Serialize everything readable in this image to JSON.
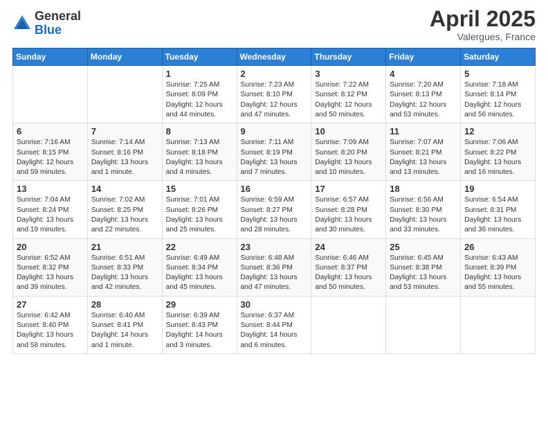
{
  "header": {
    "logo_general": "General",
    "logo_blue": "Blue",
    "month_title": "April 2025",
    "location": "Valergues, France"
  },
  "weekdays": [
    "Sunday",
    "Monday",
    "Tuesday",
    "Wednesday",
    "Thursday",
    "Friday",
    "Saturday"
  ],
  "weeks": [
    [
      {
        "day": "",
        "info": ""
      },
      {
        "day": "",
        "info": ""
      },
      {
        "day": "1",
        "info": "Sunrise: 7:25 AM\nSunset: 8:09 PM\nDaylight: 12 hours and 44 minutes."
      },
      {
        "day": "2",
        "info": "Sunrise: 7:23 AM\nSunset: 8:10 PM\nDaylight: 12 hours and 47 minutes."
      },
      {
        "day": "3",
        "info": "Sunrise: 7:22 AM\nSunset: 8:12 PM\nDaylight: 12 hours and 50 minutes."
      },
      {
        "day": "4",
        "info": "Sunrise: 7:20 AM\nSunset: 8:13 PM\nDaylight: 12 hours and 53 minutes."
      },
      {
        "day": "5",
        "info": "Sunrise: 7:18 AM\nSunset: 8:14 PM\nDaylight: 12 hours and 56 minutes."
      }
    ],
    [
      {
        "day": "6",
        "info": "Sunrise: 7:16 AM\nSunset: 8:15 PM\nDaylight: 12 hours and 59 minutes."
      },
      {
        "day": "7",
        "info": "Sunrise: 7:14 AM\nSunset: 8:16 PM\nDaylight: 13 hours and 1 minute."
      },
      {
        "day": "8",
        "info": "Sunrise: 7:13 AM\nSunset: 8:18 PM\nDaylight: 13 hours and 4 minutes."
      },
      {
        "day": "9",
        "info": "Sunrise: 7:11 AM\nSunset: 8:19 PM\nDaylight: 13 hours and 7 minutes."
      },
      {
        "day": "10",
        "info": "Sunrise: 7:09 AM\nSunset: 8:20 PM\nDaylight: 13 hours and 10 minutes."
      },
      {
        "day": "11",
        "info": "Sunrise: 7:07 AM\nSunset: 8:21 PM\nDaylight: 13 hours and 13 minutes."
      },
      {
        "day": "12",
        "info": "Sunrise: 7:06 AM\nSunset: 8:22 PM\nDaylight: 13 hours and 16 minutes."
      }
    ],
    [
      {
        "day": "13",
        "info": "Sunrise: 7:04 AM\nSunset: 8:24 PM\nDaylight: 13 hours and 19 minutes."
      },
      {
        "day": "14",
        "info": "Sunrise: 7:02 AM\nSunset: 8:25 PM\nDaylight: 13 hours and 22 minutes."
      },
      {
        "day": "15",
        "info": "Sunrise: 7:01 AM\nSunset: 8:26 PM\nDaylight: 13 hours and 25 minutes."
      },
      {
        "day": "16",
        "info": "Sunrise: 6:59 AM\nSunset: 8:27 PM\nDaylight: 13 hours and 28 minutes."
      },
      {
        "day": "17",
        "info": "Sunrise: 6:57 AM\nSunset: 8:28 PM\nDaylight: 13 hours and 30 minutes."
      },
      {
        "day": "18",
        "info": "Sunrise: 6:56 AM\nSunset: 8:30 PM\nDaylight: 13 hours and 33 minutes."
      },
      {
        "day": "19",
        "info": "Sunrise: 6:54 AM\nSunset: 8:31 PM\nDaylight: 13 hours and 36 minutes."
      }
    ],
    [
      {
        "day": "20",
        "info": "Sunrise: 6:52 AM\nSunset: 8:32 PM\nDaylight: 13 hours and 39 minutes."
      },
      {
        "day": "21",
        "info": "Sunrise: 6:51 AM\nSunset: 8:33 PM\nDaylight: 13 hours and 42 minutes."
      },
      {
        "day": "22",
        "info": "Sunrise: 6:49 AM\nSunset: 8:34 PM\nDaylight: 13 hours and 45 minutes."
      },
      {
        "day": "23",
        "info": "Sunrise: 6:48 AM\nSunset: 8:36 PM\nDaylight: 13 hours and 47 minutes."
      },
      {
        "day": "24",
        "info": "Sunrise: 6:46 AM\nSunset: 8:37 PM\nDaylight: 13 hours and 50 minutes."
      },
      {
        "day": "25",
        "info": "Sunrise: 6:45 AM\nSunset: 8:38 PM\nDaylight: 13 hours and 53 minutes."
      },
      {
        "day": "26",
        "info": "Sunrise: 6:43 AM\nSunset: 8:39 PM\nDaylight: 13 hours and 55 minutes."
      }
    ],
    [
      {
        "day": "27",
        "info": "Sunrise: 6:42 AM\nSunset: 8:40 PM\nDaylight: 13 hours and 58 minutes."
      },
      {
        "day": "28",
        "info": "Sunrise: 6:40 AM\nSunset: 8:41 PM\nDaylight: 14 hours and 1 minute."
      },
      {
        "day": "29",
        "info": "Sunrise: 6:39 AM\nSunset: 8:43 PM\nDaylight: 14 hours and 3 minutes."
      },
      {
        "day": "30",
        "info": "Sunrise: 6:37 AM\nSunset: 8:44 PM\nDaylight: 14 hours and 6 minutes."
      },
      {
        "day": "",
        "info": ""
      },
      {
        "day": "",
        "info": ""
      },
      {
        "day": "",
        "info": ""
      }
    ]
  ]
}
